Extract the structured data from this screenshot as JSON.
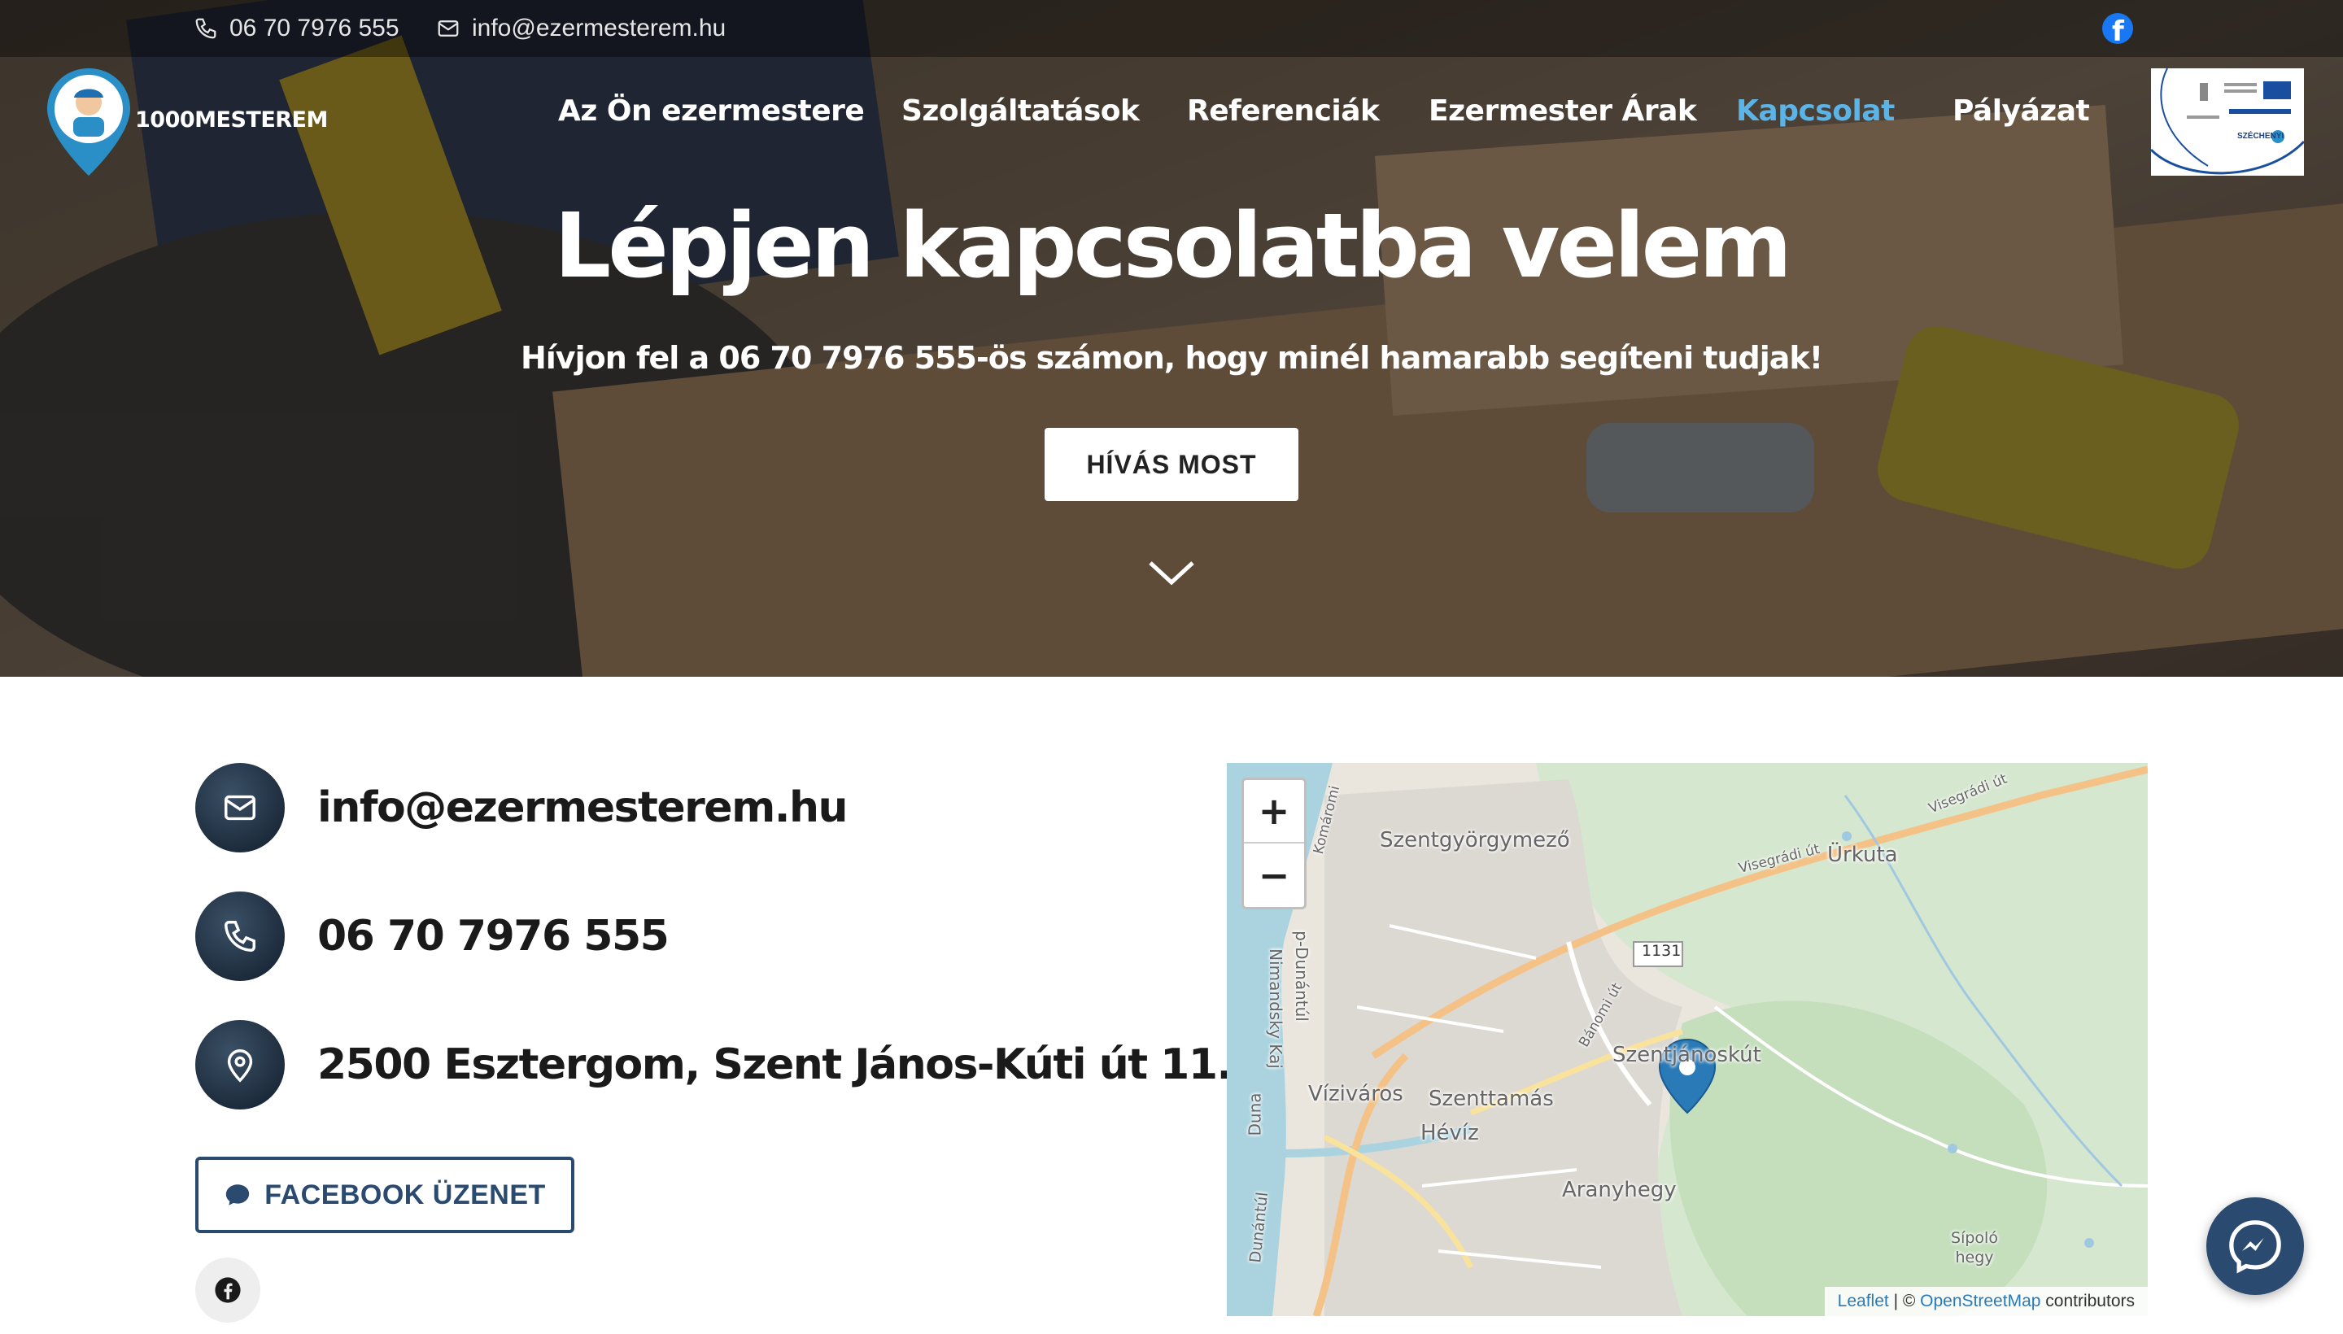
{
  "topbar": {
    "phone": "06 70 7976 555",
    "email": "info@ezermesterem.hu",
    "phone_icon": "phone-icon",
    "email_icon": "envelope-icon",
    "social_icon": "facebook-icon"
  },
  "logo": {
    "brand": "1000MESTEREM"
  },
  "nav": {
    "items": [
      {
        "label": "Az Ön ezermestere"
      },
      {
        "label": "Szolgáltatások"
      },
      {
        "label": "Referenciák"
      },
      {
        "label": "Ezermester Árak"
      },
      {
        "label": "Kapcsolat"
      },
      {
        "label": "Pályázat"
      }
    ],
    "active_index": 4,
    "active_color": "#5cb4e6"
  },
  "badge": {
    "label": "SZÉCHENYI"
  },
  "hero": {
    "title": "Lépjen kapcsolatba velem",
    "subtitle": "Hívjon fel a 06 70 7976 555-ös számon, hogy minél hamarabb segíteni tudjak!",
    "button": "HÍVÁS MOST",
    "scroll_icon": "chevron-down-icon"
  },
  "contact": {
    "email": "info@ezermesterem.hu",
    "phone": "06 70 7976 555",
    "address": "2500 Esztergom, Szent János-Kúti út 11.",
    "facebook_button": "FACEBOOK ÜZENET",
    "icon_color": "#1f3245",
    "button_color": "#2a4a70"
  },
  "map": {
    "zoom_in": "+",
    "zoom_out": "−",
    "labels": {
      "szentgyorgymezo": "Szentgyörgymező",
      "urkuta": "Ürkuta",
      "visegradi1": "Visegrádi út",
      "visegradi2": "Visegrádi út",
      "komaromi": "Komáromi",
      "nimandsky": "Nimandsky Kaj",
      "dunantul": "p-Dunántúl",
      "duna": "Duna",
      "road1131": "1131",
      "banomi": "Bánomi út",
      "szentjanoskut": "Szentjánoskút",
      "vizivaros": "Víziváros",
      "szenttamas": "Szenttamás",
      "heviz": "Hévíz",
      "aranyhegy": "Aranyhegy",
      "sipolo": "Sípoló hegy",
      "dunantul2": "Dunántúl"
    },
    "attribution": {
      "leaflet": "Leaflet",
      "sep": " | © ",
      "osm": "OpenStreetMap",
      "tail": " contributors"
    },
    "marker_icon": "map-marker-icon"
  },
  "messenger": {
    "icon": "messenger-icon"
  }
}
